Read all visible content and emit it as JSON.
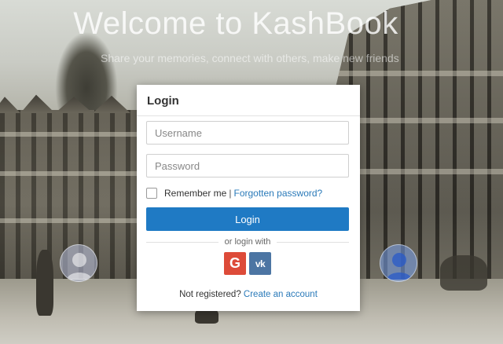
{
  "hero": {
    "title": "Welcome to KashBook",
    "subtitle": "Share your memories, connect with others, make new friends"
  },
  "login_card": {
    "heading": "Login",
    "username_placeholder": "Username",
    "password_placeholder": "Password",
    "remember_label": "Remember me",
    "separator": "|",
    "forgot_link": "Forgotten password?",
    "login_button": "Login",
    "or_text": "or login with",
    "social": {
      "google_label": "G",
      "google_icon": "google-icon",
      "google_color": "#dd4b39",
      "vk_label": "vk",
      "vk_icon": "vk-icon",
      "vk_color": "#4c75a3"
    },
    "not_registered": "Not registered?",
    "create_account": "Create an account"
  },
  "colors": {
    "primary": "#1f7ac4",
    "link": "#2a7ab9"
  },
  "icons": {
    "avatar_left": "user-avatar-icon",
    "avatar_right": "user-avatar-icon"
  }
}
